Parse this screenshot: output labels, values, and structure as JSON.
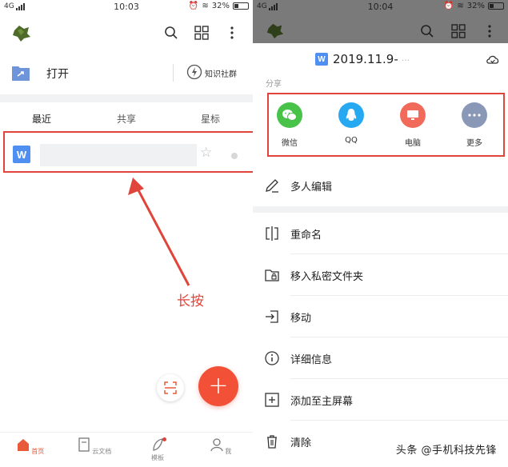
{
  "status_bar": {
    "network": "4G",
    "time_left": "10:03",
    "time_right": "10:04",
    "battery": "32%"
  },
  "left": {
    "open_label": "打开",
    "community_label": "知识社群",
    "tabs": [
      "最近",
      "共享",
      "星标"
    ],
    "file_icon_letter": "W",
    "annotation": "长按",
    "bottom_nav": [
      "首页",
      "云文档",
      "模板",
      "我"
    ],
    "fab_symbol": "+"
  },
  "right": {
    "doc_badge": "W",
    "doc_title": "2019.11.9-",
    "doc_title_tail": "···",
    "share_section_label": "分享",
    "share_targets": [
      "微信",
      "QQ",
      "电脑",
      "更多"
    ],
    "menu": [
      "多人编辑",
      "重命名",
      "移入私密文件夹",
      "移动",
      "详细信息",
      "添加至主屏幕",
      "清除"
    ],
    "watermark": "头条 @手机科技先锋"
  },
  "colors": {
    "accent_red": "#f25037",
    "annotation_red": "#e0443a",
    "doc_blue": "#4f8ff2",
    "wechat_green": "#49c24a",
    "qq_blue": "#27a9f2",
    "pc_red": "#f26a5a",
    "more_gray": "#8a98b8"
  }
}
